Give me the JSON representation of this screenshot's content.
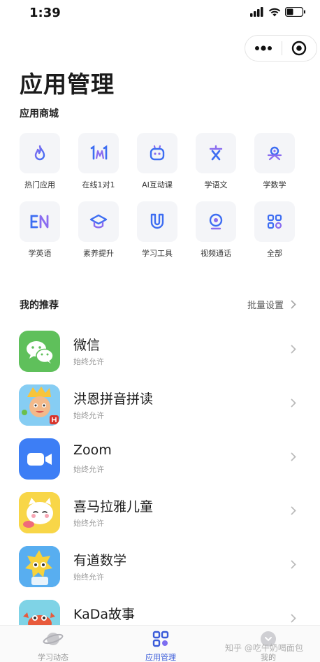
{
  "status_bar": {
    "time": "1:39"
  },
  "header": {
    "title": "应用管理"
  },
  "store": {
    "title": "应用商城",
    "items": [
      {
        "label": "热门应用",
        "icon": "flame-icon"
      },
      {
        "label": "在线1对1",
        "icon": "one-on-one-icon"
      },
      {
        "label": "AI互动课",
        "icon": "robot-icon"
      },
      {
        "label": "学语文",
        "icon": "character-icon"
      },
      {
        "label": "学数学",
        "icon": "math-icon"
      },
      {
        "label": "学英语",
        "icon": "english-icon"
      },
      {
        "label": "素养提升",
        "icon": "graduation-cap-icon"
      },
      {
        "label": "学习工具",
        "icon": "magnet-icon"
      },
      {
        "label": "视频通话",
        "icon": "webcam-icon"
      },
      {
        "label": "全部",
        "icon": "all-apps-icon"
      }
    ]
  },
  "recommend": {
    "title": "我的推荐",
    "batch_label": "批量设置",
    "apps": [
      {
        "name": "微信",
        "status": "始终允许",
        "icon": "wechat-icon"
      },
      {
        "name": "洪恩拼音拼读",
        "status": "始终允许",
        "icon": "hongen-pinyin-icon"
      },
      {
        "name": "Zoom",
        "status": "始终允许",
        "icon": "zoom-icon"
      },
      {
        "name": "喜马拉雅儿童",
        "status": "始终允许",
        "icon": "ximalaya-kids-icon"
      },
      {
        "name": "有道数学",
        "status": "始终允许",
        "icon": "youdao-math-icon"
      },
      {
        "name": "KaDa故事",
        "status": "",
        "icon": "kada-story-icon"
      }
    ]
  },
  "tabbar": {
    "tabs": [
      {
        "label": "学习动态",
        "icon": "planet-icon",
        "active": false
      },
      {
        "label": "应用管理",
        "icon": "apps-grid-icon",
        "active": true
      },
      {
        "label": "我的",
        "icon": "profile-icon",
        "active": false
      }
    ]
  },
  "watermark": "知乎 @吃午奶喝面包",
  "colors": {
    "accent": "#3a5bd9",
    "tile_bg": "#f4f5f8",
    "wechat": "#5fc05b",
    "zoom": "#3d7ef5"
  }
}
